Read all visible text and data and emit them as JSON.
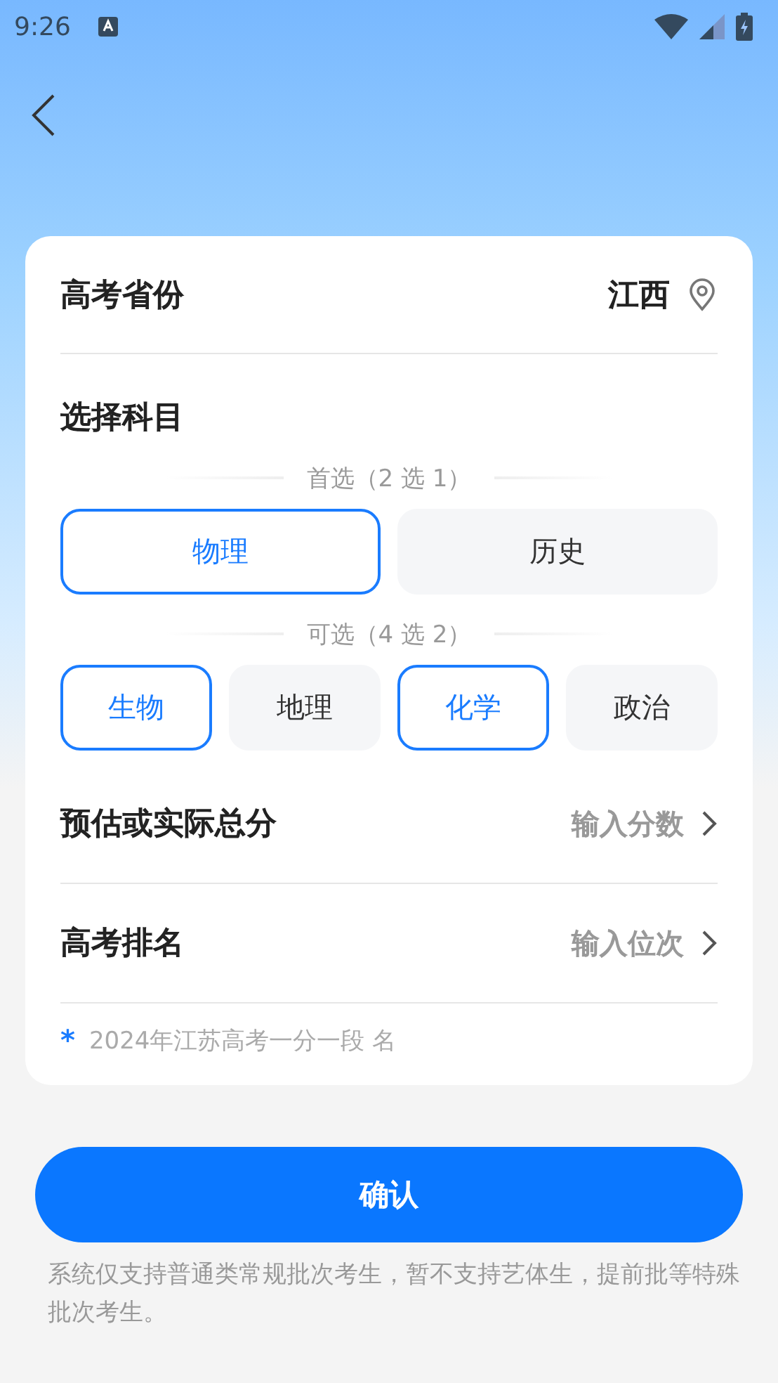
{
  "status_bar": {
    "time": "9:26"
  },
  "province": {
    "label": "高考省份",
    "value": "江西"
  },
  "subjects": {
    "title": "选择科目",
    "groups": [
      {
        "label": "首选（2 选 1）",
        "options": [
          {
            "label": "物理",
            "selected": true
          },
          {
            "label": "历史",
            "selected": false
          }
        ]
      },
      {
        "label": "可选（4 选 2）",
        "options": [
          {
            "label": "生物",
            "selected": true
          },
          {
            "label": "地理",
            "selected": false
          },
          {
            "label": "化学",
            "selected": true
          },
          {
            "label": "政治",
            "selected": false
          }
        ]
      }
    ]
  },
  "fields": [
    {
      "label": "预估或实际总分",
      "placeholder": "输入分数"
    },
    {
      "label": "高考排名",
      "placeholder": "输入位次"
    }
  ],
  "note": {
    "mark": "*",
    "text": "2024年江苏高考一分一段 名"
  },
  "confirm_button": "确认",
  "disclaimer": "系统仅支持普通类常规批次考生，暂不支持艺体生，提前批等特殊批次考生。"
}
